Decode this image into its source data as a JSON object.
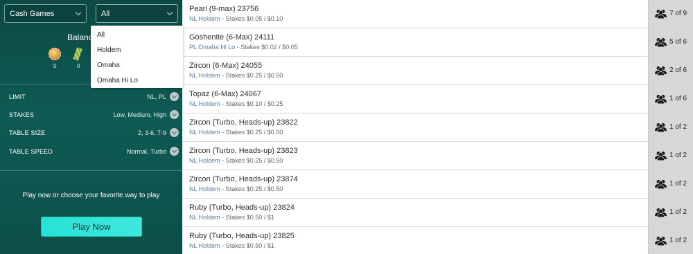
{
  "filters_panel": {
    "game_select": "Cash Games",
    "variant_select": "All",
    "balance_label": "Balance",
    "coins": [
      {
        "icon": "gold-coin-icon",
        "value": "0"
      },
      {
        "icon": "ticket-icon",
        "value": "0"
      }
    ],
    "filters": [
      {
        "key": "LIMIT",
        "value": "NL, PL"
      },
      {
        "key": "STAKES",
        "value": "Low, Medium, High"
      },
      {
        "key": "TABLE SIZE",
        "value": "2, 3-6, 7-9"
      },
      {
        "key": "TABLE SPEED",
        "value": "Normal, Turbo"
      }
    ],
    "promo_text": "Play now or choose your favorite way to play",
    "play_button": "Play Now"
  },
  "variant_dropdown": {
    "options": [
      "All",
      "Holdem",
      "Omaha",
      "Omaha Hi Lo"
    ]
  },
  "tables": [
    {
      "name": "Pearl (9-max) 23756",
      "game": "NL Holdem",
      "stakes": " - Stakes $0.05 / $0.10",
      "seats": "7 of 9"
    },
    {
      "name": "Goshenite (6-Max) 24111",
      "game": "PL Omaha Hi Lo",
      "stakes": " - Stakes $0.02 / $0.05",
      "seats": "5 of 6"
    },
    {
      "name": "Zircon (6-Max) 24055",
      "game": "NL Holdem",
      "stakes": " - Stakes $0.25 / $0.50",
      "seats": "2 of 6"
    },
    {
      "name": "Topaz (6-Max) 24067",
      "game": "NL Holdem",
      "stakes": " - Stakes $0.10 / $0.25",
      "seats": "1 of 6"
    },
    {
      "name": "Zircon (Turbo, Heads-up) 23822",
      "game": "NL Holdem",
      "stakes": " - Stakes $0.25 / $0.50",
      "seats": "1 of 2"
    },
    {
      "name": "Zircon (Turbo, Heads-up) 23823",
      "game": "NL Holdem",
      "stakes": " - Stakes $0.25 / $0.50",
      "seats": "1 of 2"
    },
    {
      "name": "Zircon (Turbo, Heads-up) 23874",
      "game": "NL Holdem",
      "stakes": " - Stakes $0.25 / $0.50",
      "seats": "1 of 2"
    },
    {
      "name": "Ruby (Turbo, Heads-up) 23824",
      "game": "NL Holdem",
      "stakes": " - Stakes $0.50 / $1",
      "seats": "1 of 2"
    },
    {
      "name": "Ruby (Turbo, Heads-up) 23825",
      "game": "NL Holdem",
      "stakes": " - Stakes $0.50 / $1",
      "seats": "1 of 2"
    }
  ],
  "colors": {
    "panel": "#0f5a54",
    "play_button": "#27e2d6",
    "game_link": "#5a7fa0",
    "seats_bg": "#d7d7d7"
  }
}
